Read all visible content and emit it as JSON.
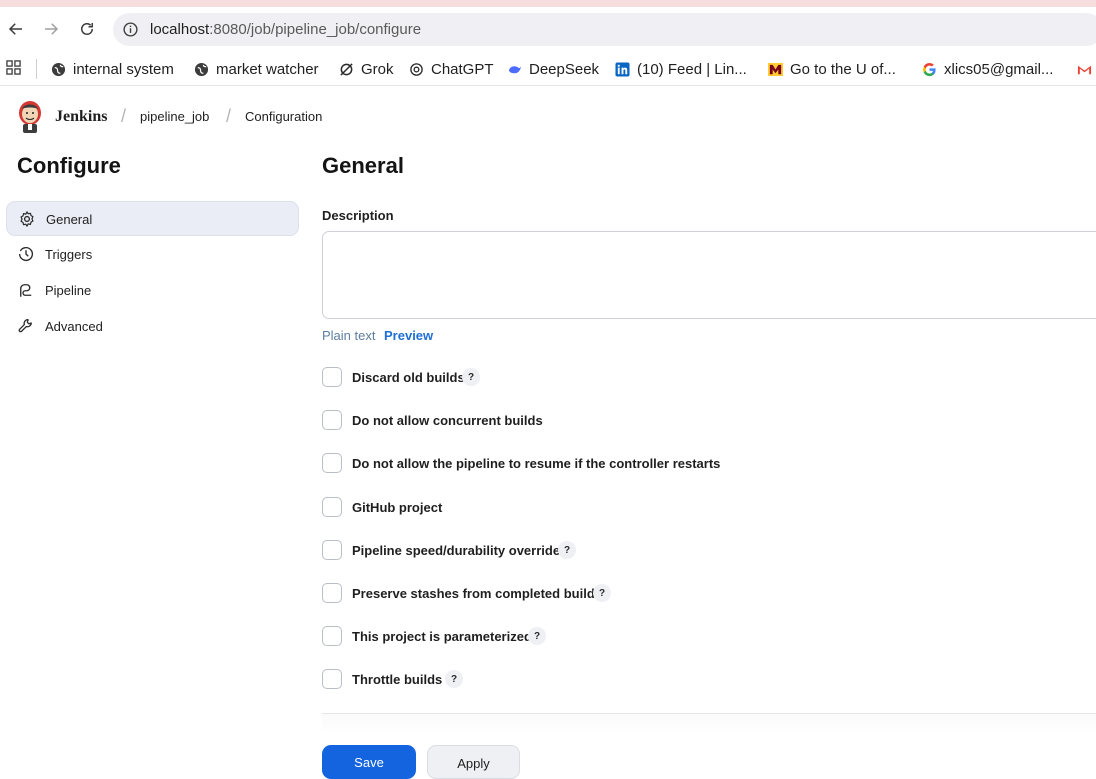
{
  "browser": {
    "url_host": "localhost",
    "url_path": ":8080/job/pipeline_job/configure",
    "bookmarks": [
      {
        "label": "internal system",
        "icon": "globe-icon"
      },
      {
        "label": "market watcher",
        "icon": "globe-icon"
      },
      {
        "label": "Grok",
        "icon": "grok-icon"
      },
      {
        "label": "ChatGPT",
        "icon": "chatgpt-icon"
      },
      {
        "label": "DeepSeek",
        "icon": "deepseek-icon"
      },
      {
        "label": "(10) Feed | Lin...",
        "icon": "linkedin-icon"
      },
      {
        "label": "Go to the U of...",
        "icon": "umn-icon"
      },
      {
        "label": "xlics05@gmail...",
        "icon": "google-icon"
      }
    ]
  },
  "header": {
    "app_name": "Jenkins",
    "breadcrumbs": [
      "pipeline_job",
      "Configuration"
    ]
  },
  "sidebar": {
    "title": "Configure",
    "items": [
      {
        "label": "General",
        "icon": "gear-icon",
        "active": true
      },
      {
        "label": "Triggers",
        "icon": "clock-icon",
        "active": false
      },
      {
        "label": "Pipeline",
        "icon": "pipeline-icon",
        "active": false
      },
      {
        "label": "Advanced",
        "icon": "wrench-icon",
        "active": false
      }
    ]
  },
  "main": {
    "section_title": "General",
    "description_label": "Description",
    "description_value": "",
    "plain_text_label": "Plain text",
    "preview_label": "Preview",
    "options": [
      {
        "label": "Discard old builds",
        "checked": false,
        "help": true
      },
      {
        "label": "Do not allow concurrent builds",
        "checked": false,
        "help": false
      },
      {
        "label": "Do not allow the pipeline to resume if the controller restarts",
        "checked": false,
        "help": false
      },
      {
        "label": "GitHub project",
        "checked": false,
        "help": false
      },
      {
        "label": "Pipeline speed/durability override",
        "checked": false,
        "help": true
      },
      {
        "label": "Preserve stashes from completed builds",
        "checked": false,
        "help": true
      },
      {
        "label": "This project is parameterized",
        "checked": false,
        "help": true
      },
      {
        "label": "Throttle builds",
        "checked": false,
        "help": true
      }
    ],
    "help_glyph": "?"
  },
  "footer": {
    "save_label": "Save",
    "apply_label": "Apply"
  },
  "colors": {
    "primary": "#1464e0",
    "link": "#1f6fd4",
    "sidebar_active_bg": "#eaedf5"
  }
}
